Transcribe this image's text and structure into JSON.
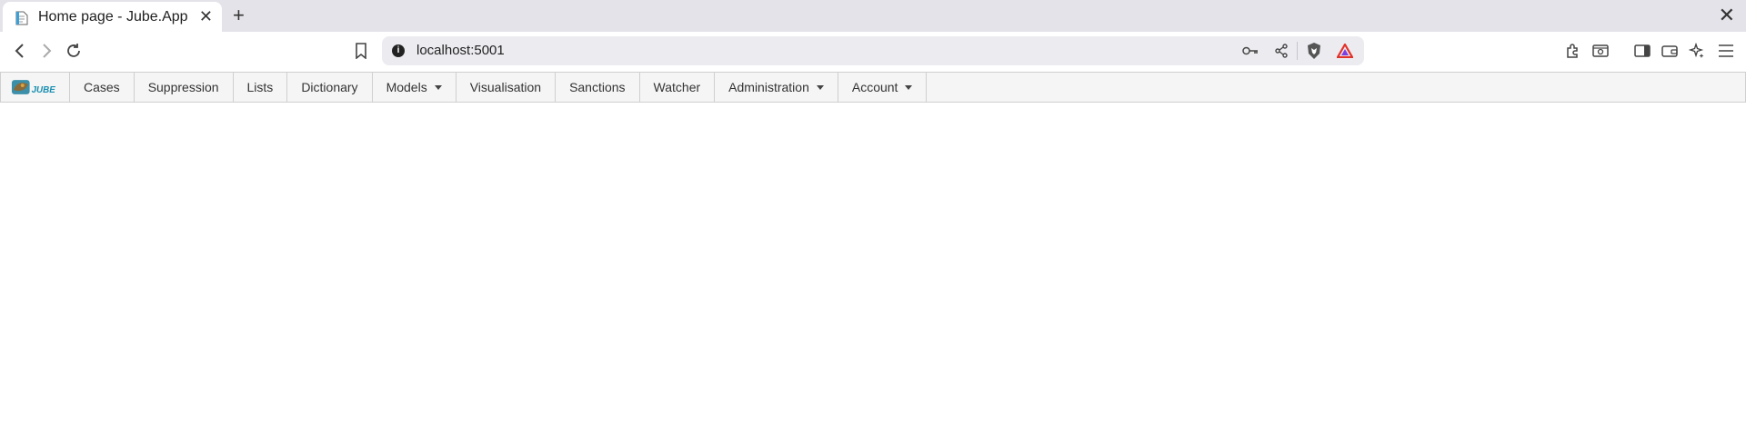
{
  "browser": {
    "tab": {
      "title": "Home page - Jube.App",
      "close": "✕"
    },
    "new_tab": "+",
    "window_close": "✕",
    "address_bar": {
      "url": "localhost:5001"
    }
  },
  "app": {
    "logo_text": "JUBE",
    "nav": [
      {
        "label": "Cases"
      },
      {
        "label": "Suppression"
      },
      {
        "label": "Lists"
      },
      {
        "label": "Dictionary"
      },
      {
        "label": "Models"
      },
      {
        "label": "Visualisation"
      },
      {
        "label": "Sanctions"
      },
      {
        "label": "Watcher"
      },
      {
        "label": "Administration"
      },
      {
        "label": "Account"
      }
    ]
  },
  "colors": {
    "brand": "#1a8fb0",
    "nav_bg": "#f5f5f5",
    "tabstrip_bg": "#e4e3e9"
  }
}
